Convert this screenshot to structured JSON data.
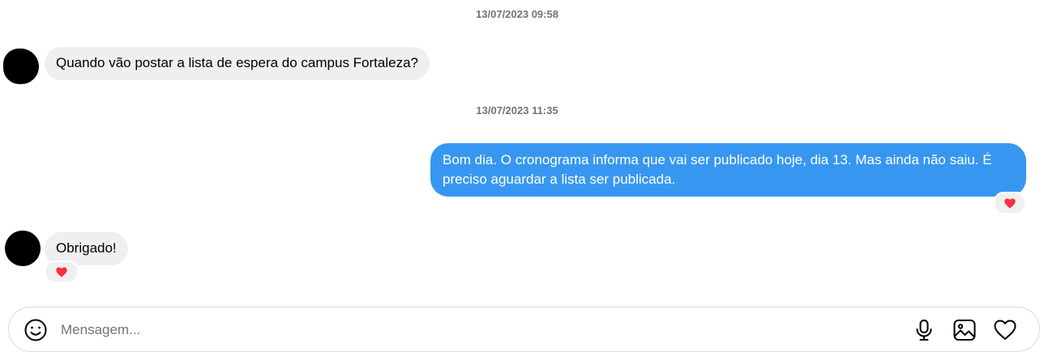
{
  "messages": [
    {
      "type": "timestamp",
      "text": "13/07/2023 09:58"
    },
    {
      "type": "incoming",
      "text": "Quando vão postar a lista de espera do campus Fortaleza?"
    },
    {
      "type": "timestamp",
      "text": "13/07/2023 11:35"
    },
    {
      "type": "outgoing",
      "text": "Bom dia. O cronograma informa que vai ser publicado hoje, dia 13. Mas ainda não saiu. É preciso aguardar a lista ser publicada.",
      "reaction": "heart-icon"
    },
    {
      "type": "incoming",
      "text": "Obrigado!",
      "reaction": "heart-icon"
    }
  ],
  "composer": {
    "placeholder": "Mensagem...",
    "value": "",
    "icons": [
      "emoji-icon",
      "microphone-icon",
      "image-icon",
      "heart-outline-icon"
    ]
  },
  "colors": {
    "outgoing_bubble": "#3797f0",
    "incoming_bubble": "#efefef",
    "reaction_heart": "#ff3040",
    "timestamp_text": "#737373"
  }
}
